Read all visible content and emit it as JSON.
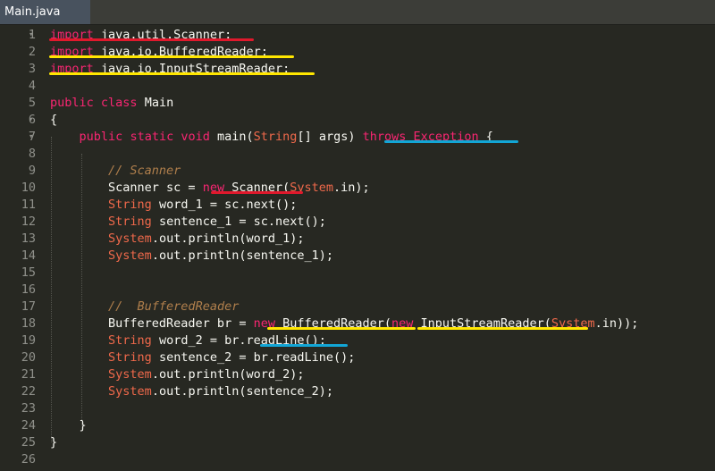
{
  "tab": {
    "label": "Main.java"
  },
  "colors": {
    "red_underline": "#e0192c",
    "yellow_underline": "#ffe600",
    "blue_underline": "#12a6d6"
  },
  "lines": [
    {
      "n": "1",
      "fold": "▾",
      "parts": [
        [
          "kw",
          "import"
        ],
        [
          "gn",
          " java.util.Scanner;"
        ]
      ]
    },
    {
      "n": "2",
      "fold": "",
      "parts": [
        [
          "kw",
          "import"
        ],
        [
          "gn",
          " java.io.BufferedReader;"
        ]
      ]
    },
    {
      "n": "3",
      "fold": "",
      "parts": [
        [
          "kw",
          "import"
        ],
        [
          "gn",
          " java.io.InputStreamReader;"
        ]
      ]
    },
    {
      "n": "4",
      "fold": "",
      "parts": []
    },
    {
      "n": "5",
      "fold": "",
      "parts": [
        [
          "kw",
          "public"
        ],
        [
          "gn",
          " "
        ],
        [
          "kw",
          "class"
        ],
        [
          "gn",
          " Main"
        ]
      ]
    },
    {
      "n": "6",
      "fold": "▾",
      "parts": [
        [
          "gn",
          "{"
        ]
      ]
    },
    {
      "n": "7",
      "fold": "▾",
      "parts": [
        [
          "gn",
          "    "
        ],
        [
          "kw",
          "public"
        ],
        [
          "gn",
          " "
        ],
        [
          "kw",
          "static"
        ],
        [
          "gn",
          " "
        ],
        [
          "kw",
          "void"
        ],
        [
          "gn",
          " main("
        ],
        [
          "ty2",
          "String"
        ],
        [
          "gn",
          "[] args) "
        ],
        [
          "kw",
          "throws"
        ],
        [
          "gn",
          " "
        ],
        [
          "kw",
          "Exception"
        ],
        [
          "gn",
          " {"
        ]
      ]
    },
    {
      "n": "8",
      "fold": "",
      "parts": []
    },
    {
      "n": "9",
      "fold": "",
      "parts": [
        [
          "gn",
          "        "
        ],
        [
          "cm",
          "// Scanner"
        ]
      ]
    },
    {
      "n": "10",
      "fold": "",
      "parts": [
        [
          "gn",
          "        Scanner sc = "
        ],
        [
          "kw",
          "new"
        ],
        [
          "gn",
          " Scanner("
        ],
        [
          "ty2",
          "System"
        ],
        [
          "gn",
          ".in);"
        ]
      ]
    },
    {
      "n": "11",
      "fold": "",
      "parts": [
        [
          "gn",
          "        "
        ],
        [
          "ty2",
          "String"
        ],
        [
          "gn",
          " word_1 = sc.next();"
        ]
      ]
    },
    {
      "n": "12",
      "fold": "",
      "parts": [
        [
          "gn",
          "        "
        ],
        [
          "ty2",
          "String"
        ],
        [
          "gn",
          " sentence_1 = sc.next();"
        ]
      ]
    },
    {
      "n": "13",
      "fold": "",
      "parts": [
        [
          "gn",
          "        "
        ],
        [
          "ty2",
          "System"
        ],
        [
          "gn",
          ".out.println(word_1);"
        ]
      ]
    },
    {
      "n": "14",
      "fold": "",
      "parts": [
        [
          "gn",
          "        "
        ],
        [
          "ty2",
          "System"
        ],
        [
          "gn",
          ".out.println(sentence_1);"
        ]
      ]
    },
    {
      "n": "15",
      "fold": "",
      "parts": []
    },
    {
      "n": "16",
      "fold": "",
      "parts": []
    },
    {
      "n": "17",
      "fold": "",
      "parts": [
        [
          "gn",
          "        "
        ],
        [
          "cm",
          "//  BufferedReader"
        ]
      ]
    },
    {
      "n": "18",
      "fold": "",
      "parts": [
        [
          "gn",
          "        BufferedReader br = "
        ],
        [
          "kw",
          "new"
        ],
        [
          "gn",
          " BufferedReader("
        ],
        [
          "kw",
          "new"
        ],
        [
          "gn",
          " InputStreamReader("
        ],
        [
          "ty2",
          "System"
        ],
        [
          "gn",
          ".in));"
        ]
      ]
    },
    {
      "n": "19",
      "fold": "",
      "parts": [
        [
          "gn",
          "        "
        ],
        [
          "ty2",
          "String"
        ],
        [
          "gn",
          " word_2 = br.readLine();"
        ]
      ]
    },
    {
      "n": "20",
      "fold": "",
      "parts": [
        [
          "gn",
          "        "
        ],
        [
          "ty2",
          "String"
        ],
        [
          "gn",
          " sentence_2 = br.readLine();"
        ]
      ]
    },
    {
      "n": "21",
      "fold": "",
      "parts": [
        [
          "gn",
          "        "
        ],
        [
          "ty2",
          "System"
        ],
        [
          "gn",
          ".out.println(word_2);"
        ]
      ]
    },
    {
      "n": "22",
      "fold": "",
      "parts": [
        [
          "gn",
          "        "
        ],
        [
          "ty2",
          "System"
        ],
        [
          "gn",
          ".out.println(sentence_2);"
        ]
      ]
    },
    {
      "n": "23",
      "fold": "",
      "parts": []
    },
    {
      "n": "24",
      "fold": "",
      "parts": [
        [
          "gn",
          "    }"
        ]
      ]
    },
    {
      "n": "25",
      "fold": "",
      "parts": [
        [
          "gn",
          "}"
        ]
      ]
    },
    {
      "n": "26",
      "fold": "",
      "parts": []
    }
  ]
}
